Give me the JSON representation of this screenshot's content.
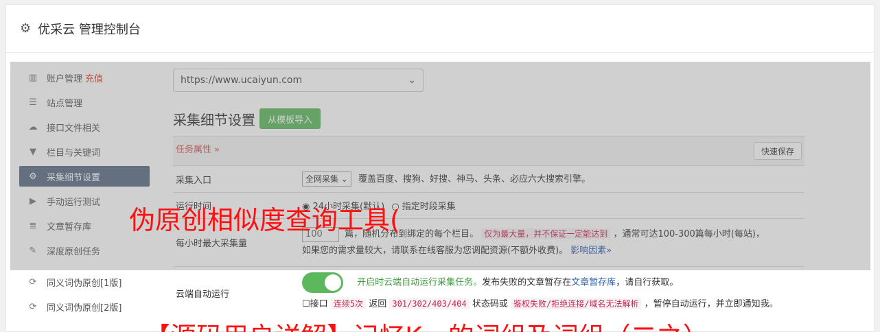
{
  "header": {
    "gear_icon": "gear-icon",
    "title": "优采云 管理控制台"
  },
  "sidebar": {
    "items": [
      {
        "icon": "bar-chart-icon",
        "label": "账户管理",
        "badge": "充值"
      },
      {
        "icon": "server-icon",
        "label": "站点管理"
      },
      {
        "icon": "cloud-upload-icon",
        "label": "接口文件相关"
      },
      {
        "icon": "filter-icon",
        "label": "栏目与关键词"
      },
      {
        "icon": "cogs-icon",
        "label": "采集细节设置",
        "active": true
      },
      {
        "icon": "play-icon",
        "label": "手动运行测试"
      },
      {
        "icon": "database-icon",
        "label": "文章暂存库"
      },
      {
        "icon": "edit-icon",
        "label": "深度原创任务"
      },
      {
        "icon": "refresh-icon",
        "label": "同义词伪原创[1版]"
      },
      {
        "icon": "refresh-icon",
        "label": "同义词伪原创[2版]"
      }
    ]
  },
  "main": {
    "site_select": "https://www.ucaiyun.com",
    "section_title": "采集细节设置",
    "import_button": "从模板导入",
    "task_attr": "任务属性 »",
    "quick_save": "快速保存",
    "rows": {
      "entry_label": "采集入口",
      "entry_select": "全网采集",
      "entry_desc": "覆盖百度、搜狗、好搜、神马、头条、必应六大搜索引擎。",
      "runtime_label": "运行时间",
      "runtime_opt1": "24小时采集(默认)",
      "runtime_opt2": "指定时段采集",
      "max_label": "每小时最大采集量",
      "max_value": "100",
      "max_desc1": "篇，随机分布到绑定的每个栏目。",
      "max_note": "仅为最大量，并不保证一定能达到",
      "max_desc2": "，通常可达100-300篇每小时(每站)，",
      "max_desc3": "如果您的需求量较大，请联系在线客服为您调配资源(不额外收费)。",
      "max_link": "影响因素»",
      "cloud_label": "云端自动运行",
      "cloud_desc1": "开启时云端自动运行采集任务。",
      "cloud_desc2": "发布失败的文章暂存在",
      "cloud_link": "文章暂存库",
      "cloud_desc3": "，请自行获取。",
      "api_label": "接口",
      "api_code1": "连续5次",
      "api_text1": "返回",
      "api_code2": "301/302/403/404",
      "api_text2": "状态码或",
      "api_code3": "鉴权失败/拒绝连接/域名无法解析",
      "api_text3": "，暂停自动运行，并立即通知我。"
    }
  },
  "watermark": {
    "line1": "伪原创相似度查询工具(",
    "line2": "【源码用户详解】记忆K - 的词组及词组（二之）"
  }
}
